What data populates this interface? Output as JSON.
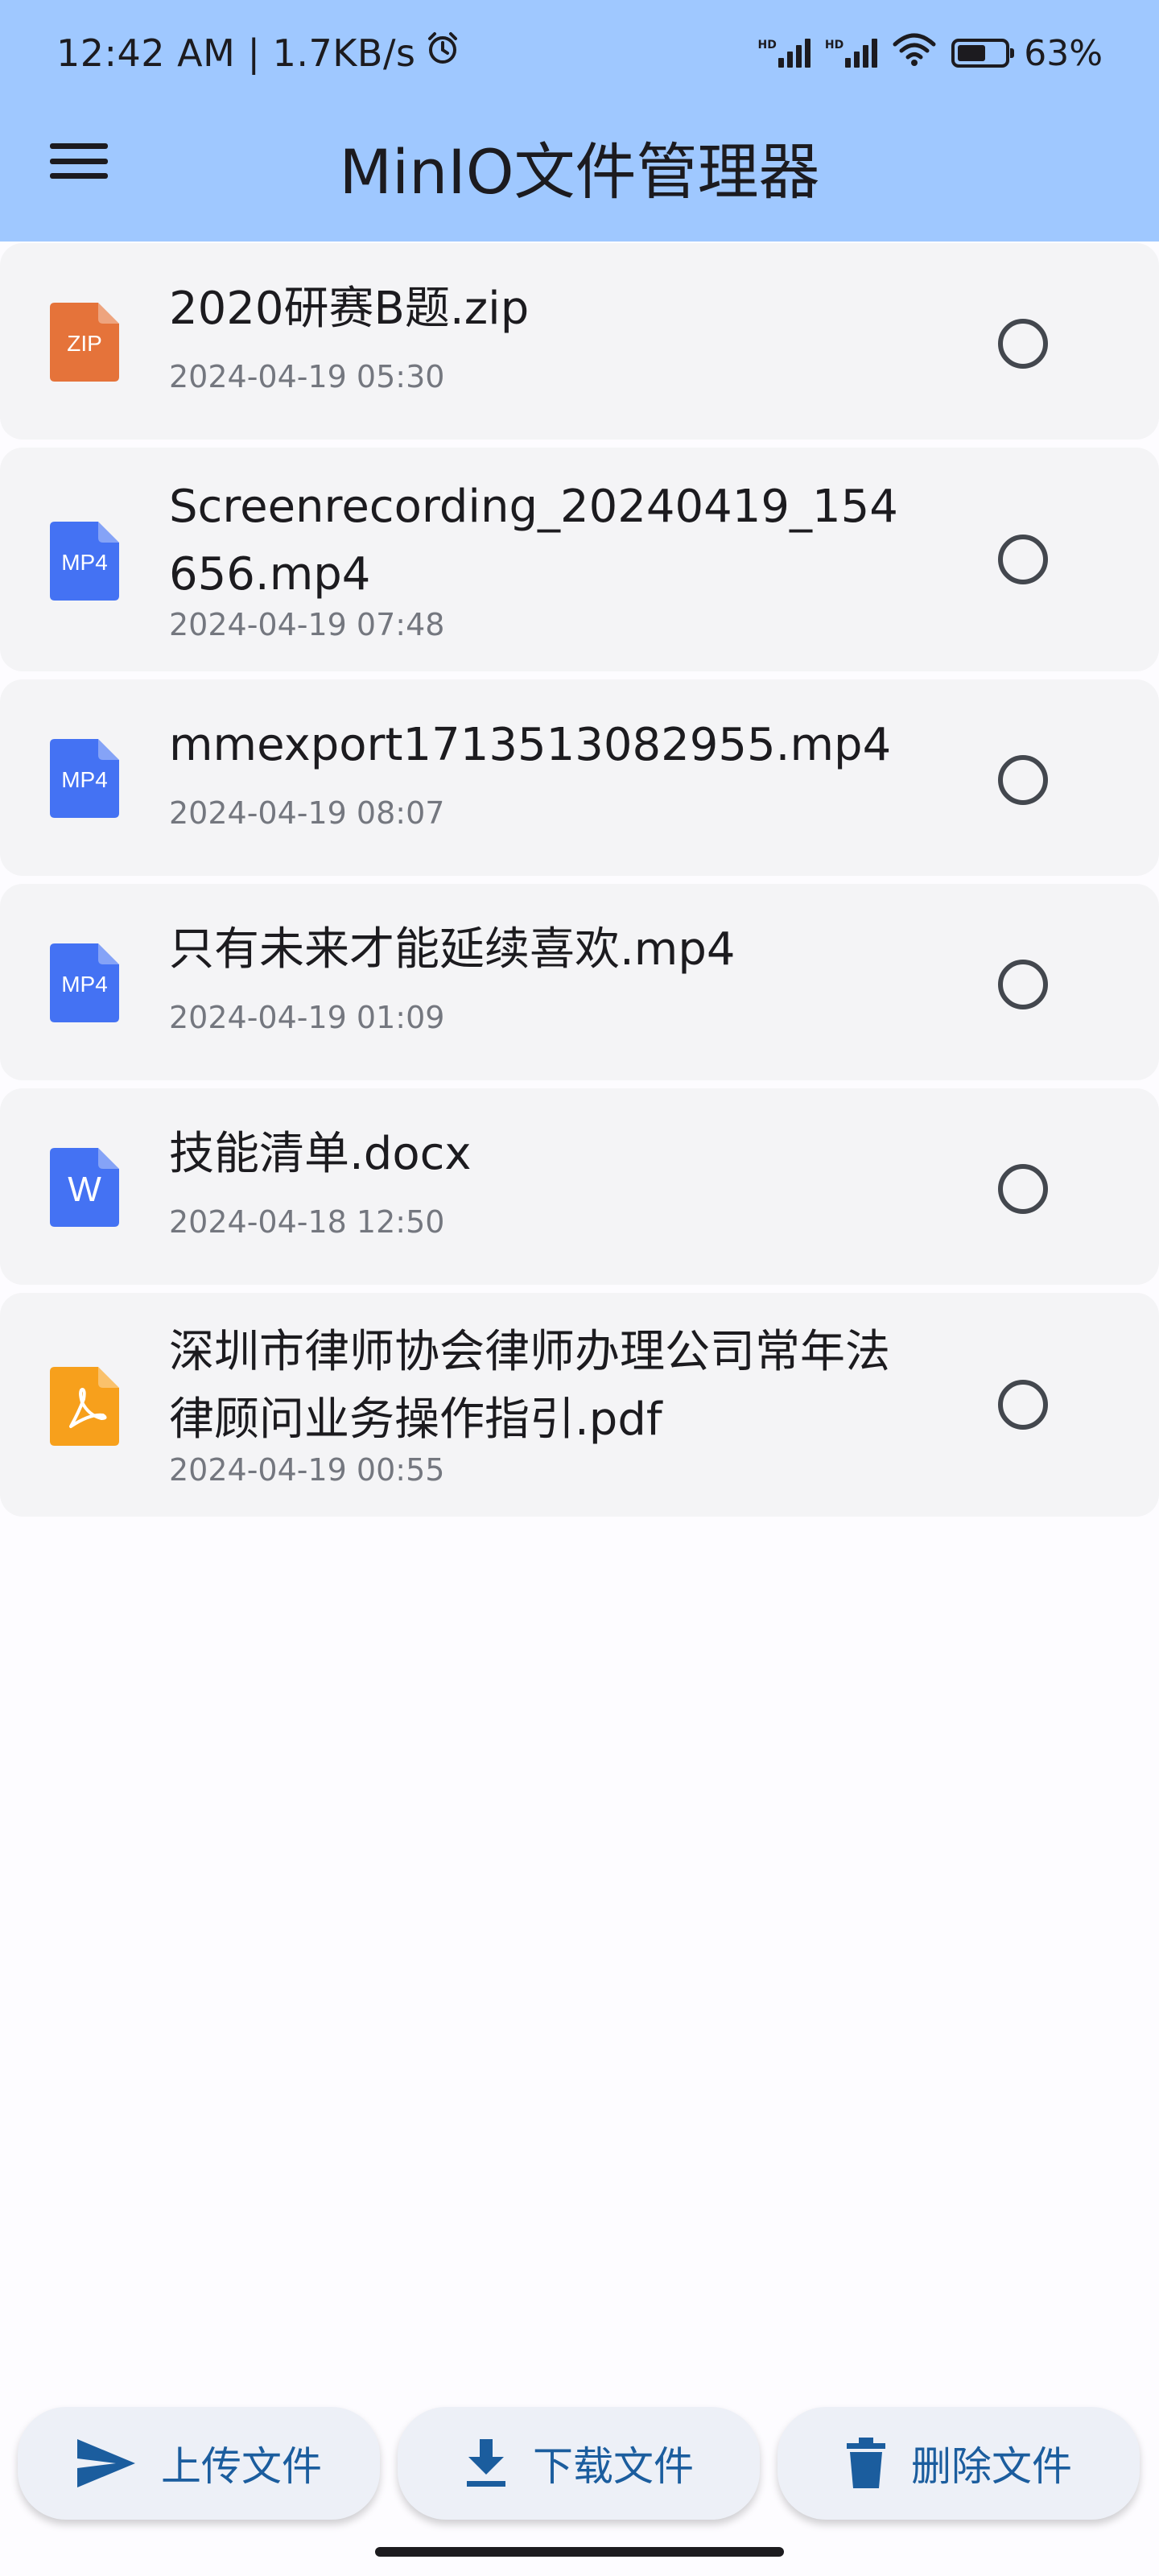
{
  "status_bar": {
    "time": "12:42 AM | 1.7KB/s",
    "sim1": "HD",
    "sim2": "HD",
    "battery_percent": "63%",
    "battery_level": 0.63
  },
  "app_bar": {
    "title": "MinIO文件管理器",
    "background_color": "#9fc8ff"
  },
  "files": [
    {
      "name": "2020研赛B题.zip",
      "date": "2024-04-19 05:30",
      "type_label": "ZIP",
      "icon": "zip-file-icon",
      "icon_color": "#e5733a",
      "selected": false
    },
    {
      "name": "Screenrecording_20240419_154656.mp4",
      "date": "2024-04-19 07:48",
      "type_label": "MP4",
      "icon": "mp4-file-icon",
      "icon_color": "#4472f3",
      "selected": false
    },
    {
      "name": "mmexport1713513082955.mp4",
      "date": "2024-04-19 08:07",
      "type_label": "MP4",
      "icon": "mp4-file-icon",
      "icon_color": "#4472f3",
      "selected": false
    },
    {
      "name": "只有未来才能延续喜欢.mp4",
      "date": "2024-04-19 01:09",
      "type_label": "MP4",
      "icon": "mp4-file-icon",
      "icon_color": "#4472f3",
      "selected": false
    },
    {
      "name": "技能清单.docx",
      "date": "2024-04-18 12:50",
      "type_label": "W",
      "icon": "word-file-icon",
      "icon_color": "#4472f3",
      "selected": false
    },
    {
      "name": "深圳市律师协会律师办理公司常年法律顾问业务操作指引.pdf",
      "date": "2024-04-19 00:55",
      "type_label": "",
      "icon": "pdf-file-icon",
      "icon_color": "#f7a01c",
      "selected": false
    }
  ],
  "actions": {
    "upload_label": "上传文件",
    "download_label": "下载文件",
    "delete_label": "删除文件",
    "accent_color": "#1b5d9e"
  }
}
